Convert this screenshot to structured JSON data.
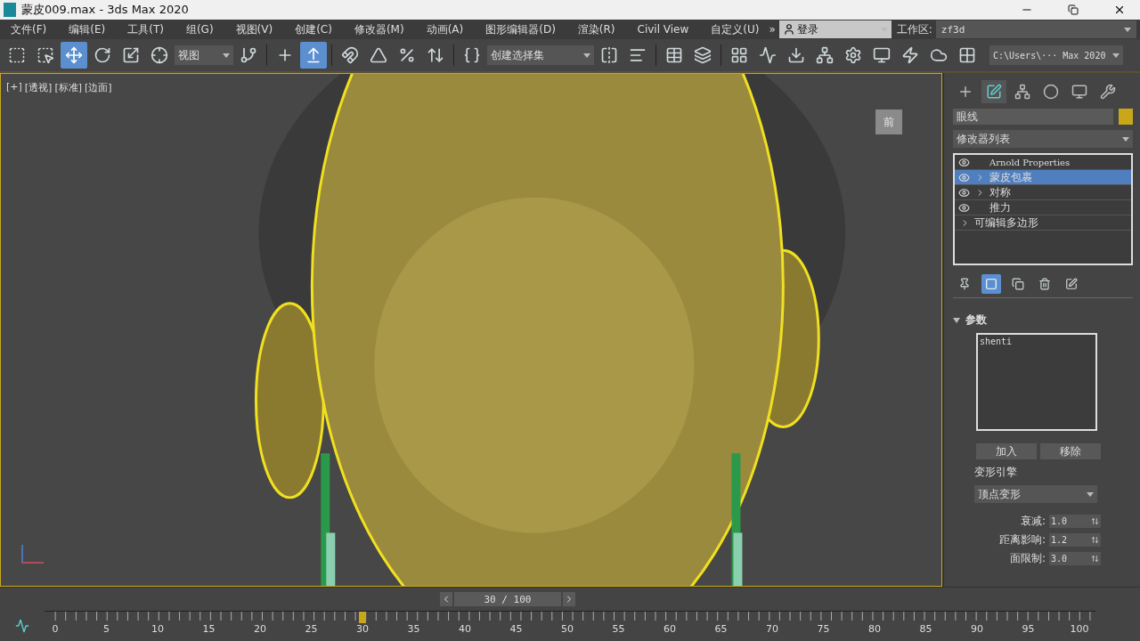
{
  "window": {
    "title": "蒙皮009.max - 3ds Max 2020"
  },
  "menu": [
    "文件(F)",
    "编辑(E)",
    "工具(T)",
    "组(G)",
    "视图(V)",
    "创建(C)",
    "修改器(M)",
    "动画(A)",
    "图形编辑器(D)",
    "渲染(R)",
    "Civil View",
    "自定义(U)"
  ],
  "menu_overflow": "»",
  "account": {
    "label": "登录"
  },
  "workspace": {
    "label": "工作区:",
    "value": "zf3d"
  },
  "toolbar": [
    {
      "kind": "tool",
      "selected": false
    },
    {
      "kind": "tool",
      "selected": false
    },
    {
      "kind": "tool",
      "selected": true
    },
    {
      "kind": "tool",
      "selected": false
    },
    {
      "kind": "tool",
      "selected": false
    },
    {
      "kind": "tool",
      "selected": false
    },
    {
      "kind": "dropdown",
      "value": "视图"
    },
    {
      "kind": "tool",
      "selected": false
    },
    {
      "kind": "separator"
    },
    {
      "kind": "tool",
      "selected": false
    },
    {
      "kind": "tool",
      "selected": true
    },
    {
      "kind": "separator"
    },
    {
      "kind": "tool",
      "selected": false
    },
    {
      "kind": "tool",
      "selected": false
    },
    {
      "kind": "tool",
      "selected": false
    },
    {
      "kind": "tool",
      "selected": false
    },
    {
      "kind": "separator"
    },
    {
      "kind": "tool",
      "selected": false
    },
    {
      "kind": "dropdown",
      "value": "创建选择集"
    },
    {
      "kind": "tool",
      "selected": false
    },
    {
      "kind": "tool",
      "selected": false
    },
    {
      "kind": "separator"
    },
    {
      "kind": "tool",
      "selected": false
    },
    {
      "kind": "tool",
      "selected": false
    },
    {
      "kind": "separator"
    },
    {
      "kind": "tool",
      "selected": false
    },
    {
      "kind": "tool",
      "selected": false
    },
    {
      "kind": "tool",
      "selected": false
    },
    {
      "kind": "tool",
      "selected": false
    },
    {
      "kind": "tool",
      "selected": false
    },
    {
      "kind": "tool",
      "selected": false
    },
    {
      "kind": "tool",
      "selected": false
    },
    {
      "kind": "tool",
      "selected": false
    },
    {
      "kind": "tool",
      "selected": false
    },
    {
      "kind": "path",
      "value": "C:\\Users\\··· Max 2020"
    }
  ],
  "viewport": {
    "labels": [
      "[+]",
      "[透视]",
      "[标准]",
      "[边面]"
    ],
    "viewcube": "前"
  },
  "command_panel": {
    "tabs": [
      {
        "selected": false
      },
      {
        "selected": true
      },
      {
        "selected": false
      },
      {
        "selected": false
      },
      {
        "selected": false
      },
      {
        "selected": false
      }
    ],
    "object_name": "眼线",
    "modifier_list": "修改器列表",
    "stack": [
      {
        "label": "Arnold Properties",
        "visible": true,
        "expandable": false,
        "selected": false
      },
      {
        "label": "蒙皮包裹",
        "visible": true,
        "expandable": true,
        "selected": true
      },
      {
        "label": "对称",
        "visible": true,
        "expandable": true,
        "selected": false
      },
      {
        "label": "推力",
        "visible": true,
        "expandable": false,
        "selected": false
      },
      {
        "label": "可编辑多边形",
        "visible": false,
        "expandable": true,
        "selected": false
      }
    ],
    "stack_tools": [
      {
        "selected": false
      },
      {
        "selected": true
      },
      {
        "selected": false
      },
      {
        "selected": false
      },
      {
        "selected": false
      }
    ],
    "rollout": {
      "title": "参数",
      "expanded": true,
      "objects": [
        "shenti"
      ],
      "buttons": [
        "加入",
        "移除"
      ],
      "engine_label": "变形引擎",
      "engine_value": "顶点变形",
      "spinners": [
        {
          "label": "衰减:",
          "value": "1.0"
        },
        {
          "label": "距离影响:",
          "value": "1.2"
        },
        {
          "label": "面限制:",
          "value": "3.0"
        }
      ]
    }
  },
  "timeline": {
    "frame": "30 / 100",
    "level": 0.3,
    "ticks": [
      "0",
      "5",
      "10",
      "15",
      "20",
      "25",
      "30",
      "35",
      "40",
      "45",
      "50",
      "55",
      "60",
      "65",
      "70",
      "75",
      "80",
      "85",
      "90",
      "95",
      "100"
    ]
  }
}
